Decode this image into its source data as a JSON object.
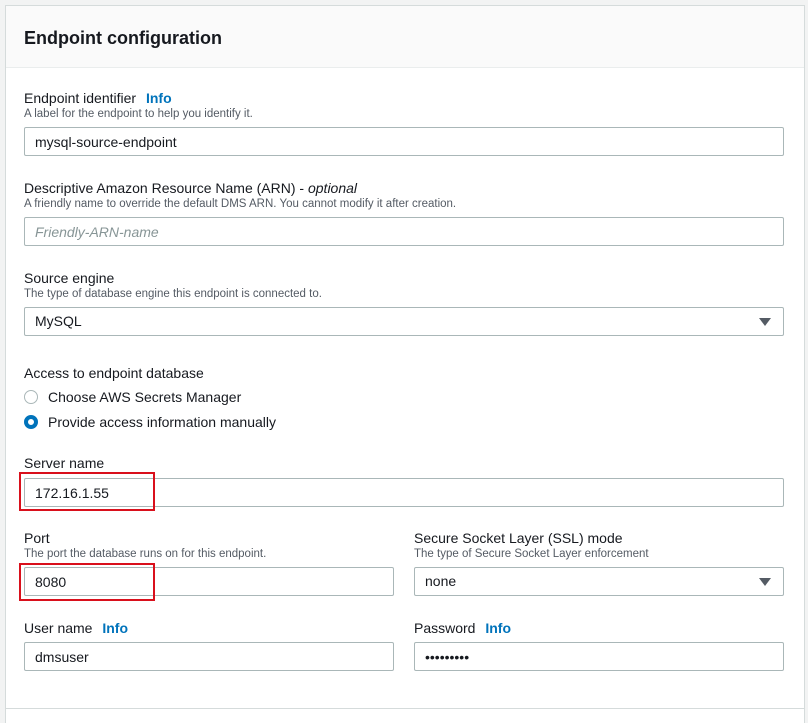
{
  "panel": {
    "title": "Endpoint configuration"
  },
  "fields": {
    "identifier": {
      "label": "Endpoint identifier",
      "info": "Info",
      "description": "A label for the endpoint to help you identify it.",
      "value": "mysql-source-endpoint"
    },
    "arn": {
      "label_main": "Descriptive Amazon Resource Name (ARN) - ",
      "label_optional": "optional",
      "description": "A friendly name to override the default DMS ARN. You cannot modify it after creation.",
      "value": "",
      "placeholder": "Friendly-ARN-name"
    },
    "source_engine": {
      "label": "Source engine",
      "description": "The type of database engine this endpoint is connected to.",
      "selected": "MySQL"
    },
    "access": {
      "label": "Access to endpoint database",
      "options": [
        {
          "label": "Choose AWS Secrets Manager",
          "selected": false
        },
        {
          "label": "Provide access information manually",
          "selected": true
        }
      ]
    },
    "server_name": {
      "label": "Server name",
      "value": "172.16.1.55"
    },
    "port": {
      "label": "Port",
      "description": "The port the database runs on for this endpoint.",
      "value": "8080"
    },
    "ssl_mode": {
      "label": "Secure Socket Layer (SSL) mode",
      "description": "The type of Secure Socket Layer enforcement",
      "selected": "none"
    },
    "user_name": {
      "label": "User name",
      "info": "Info",
      "value": "dmsuser"
    },
    "password": {
      "label": "Password",
      "info": "Info",
      "value": "•••••••••"
    }
  },
  "colors": {
    "link": "#0073bb",
    "highlight": "#d9101c",
    "radio_selected": "#0073bb"
  },
  "icons": {
    "dropdown": "caret-down-icon"
  }
}
